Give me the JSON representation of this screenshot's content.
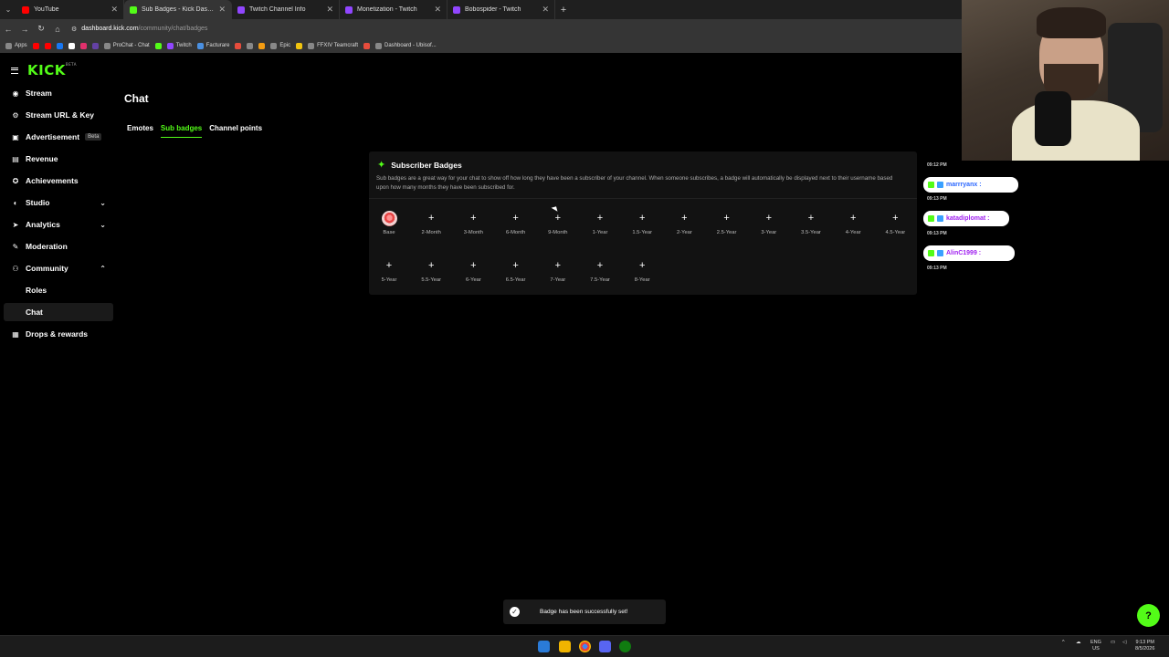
{
  "browser": {
    "tabs": [
      {
        "title": "YouTube",
        "color": "#ff0000",
        "active": false
      },
      {
        "title": "Sub Badges - Kick Dashboard",
        "color": "#53fc18",
        "active": true
      },
      {
        "title": "Twitch Channel Info",
        "color": "#9146ff",
        "active": false
      },
      {
        "title": "Monetization - Twitch",
        "color": "#9146ff",
        "active": false
      },
      {
        "title": "Bobospider - Twitch",
        "color": "#9146ff",
        "active": false
      }
    ],
    "url_host": "dashboard.kick.com",
    "url_path": "/community/chat/badges",
    "bookmarks": [
      {
        "label": "Apps",
        "color": "#888"
      },
      {
        "label": "",
        "color": "#ff0000"
      },
      {
        "label": "",
        "color": "#ff0000"
      },
      {
        "label": "",
        "color": "#1877f2"
      },
      {
        "label": "",
        "color": "#ffffff"
      },
      {
        "label": "",
        "color": "#e1306c"
      },
      {
        "label": "",
        "color": "#6441a5"
      },
      {
        "label": "ProChat - Chat",
        "color": "#888"
      },
      {
        "label": "",
        "color": "#53fc18"
      },
      {
        "label": "Twitch",
        "color": "#9146ff"
      },
      {
        "label": "Facturare",
        "color": "#4a90e2"
      },
      {
        "label": "",
        "color": "#e74c3c"
      },
      {
        "label": "",
        "color": "#888"
      },
      {
        "label": "",
        "color": "#f39c12"
      },
      {
        "label": "Epic",
        "color": "#888"
      },
      {
        "label": "",
        "color": "#f1c40f"
      },
      {
        "label": "FFXIV Teamcraft",
        "color": "#888"
      },
      {
        "label": "",
        "color": "#e74c3c"
      },
      {
        "label": "Dashboard - Ubisof...",
        "color": "#888"
      }
    ]
  },
  "sidebar": {
    "logo": "KICK",
    "logo_tag": "BETA",
    "items": [
      {
        "label": "Stream",
        "icon": "broadcast-icon",
        "glyph": "◉"
      },
      {
        "label": "Stream URL & Key",
        "icon": "key-icon",
        "glyph": "⚙"
      },
      {
        "label": "Advertisement",
        "icon": "ad-icon",
        "glyph": "▣",
        "badge": "Beta"
      },
      {
        "label": "Revenue",
        "icon": "revenue-icon",
        "glyph": "▤"
      },
      {
        "label": "Achievements",
        "icon": "trophy-icon",
        "glyph": "✪"
      },
      {
        "label": "Studio",
        "icon": "studio-icon",
        "glyph": "◐",
        "chevron": "⌄"
      },
      {
        "label": "Analytics",
        "icon": "analytics-icon",
        "glyph": "➤",
        "chevron": "⌄"
      },
      {
        "label": "Moderation",
        "icon": "moderation-icon",
        "glyph": "✎"
      },
      {
        "label": "Community",
        "icon": "community-icon",
        "glyph": "⚇",
        "chevron": "⌃"
      },
      {
        "label": "Roles"
      },
      {
        "label": "Chat"
      },
      {
        "label": "Drops & rewards",
        "icon": "gift-icon",
        "glyph": "▦"
      }
    ]
  },
  "main": {
    "title": "Chat",
    "tabs": [
      "Emotes",
      "Sub badges",
      "Channel points"
    ],
    "panel": {
      "title": "Subscriber Badges",
      "description": "Sub badges are a great way for your chat to show off how long they have been a subscriber of your channel. When someone subscribes, a badge will automatically be displayed next to their username based upon how many months they have been subscribed for.",
      "badges": [
        "Base",
        "2-Month",
        "3-Month",
        "6-Month",
        "9-Month",
        "1-Year",
        "1.5-Year",
        "2-Year",
        "2.5-Year",
        "3-Year",
        "3.5-Year",
        "4-Year",
        "4.5-Year",
        "5-Year",
        "5.5-Year",
        "6-Year",
        "6.5-Year",
        "7-Year",
        "7.5-Year",
        "8-Year"
      ],
      "add_glyph": "+"
    }
  },
  "chat_overlay": {
    "timestamps": [
      "09:12 PM",
      "09:13 PM",
      "09:13 PM",
      "09:13 PM"
    ],
    "messages": [
      {
        "user": "marrryanx :",
        "color": "#2a66ff"
      },
      {
        "user": "katadiplomat :",
        "color": "#a020f0"
      },
      {
        "user": "AlinC1999 :",
        "color": "#a020f0"
      }
    ]
  },
  "toast": {
    "text": "Badge has been successfully set!",
    "glyph": "✓"
  },
  "taskbar": {
    "lang1": "ENG",
    "lang2": "US",
    "time": "9:13 PM",
    "date": "8/5/2026"
  }
}
